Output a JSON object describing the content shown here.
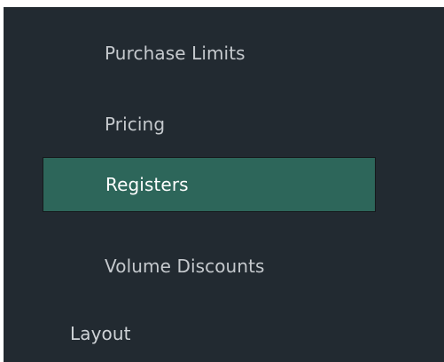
{
  "nav": {
    "items": [
      {
        "label": "Purchase Limits",
        "active": false
      },
      {
        "label": "Pricing",
        "active": false
      },
      {
        "label": "Registers",
        "active": true
      },
      {
        "label": "Volume Discounts",
        "active": false
      }
    ],
    "section": {
      "label": "Layout"
    }
  },
  "colors": {
    "panel_background": "#222a31",
    "active_background": "#2d665a",
    "text": "#c5c9cd",
    "active_text": "#ffffff"
  }
}
